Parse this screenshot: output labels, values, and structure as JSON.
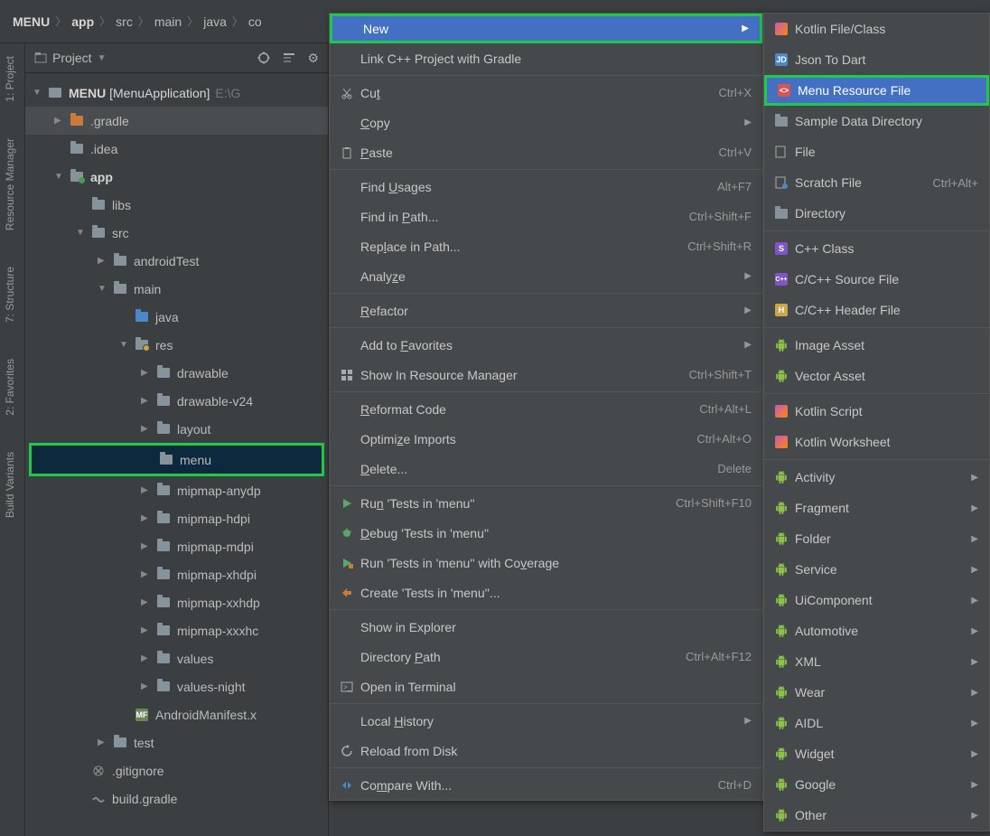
{
  "breadcrumb": [
    "MENU",
    "app",
    "src",
    "main",
    "java",
    "co"
  ],
  "left_rail": [
    {
      "label": "1: Project"
    },
    {
      "label": "Resource Manager"
    },
    {
      "label": "7: Structure"
    },
    {
      "label": "2: Favorites"
    },
    {
      "label": "Build Variants"
    }
  ],
  "project_header": {
    "title": "Project"
  },
  "tree": [
    {
      "indent": 0,
      "arrow": "▼",
      "icon": "module",
      "label": "MENU",
      "bold": true,
      "bracket": "[MenuApplication]",
      "hint": "E:\\G"
    },
    {
      "indent": 1,
      "arrow": "▶",
      "icon": "folder-orange",
      "label": ".gradle",
      "selectedBg": true
    },
    {
      "indent": 1,
      "arrow": "",
      "icon": "folder",
      "label": ".idea"
    },
    {
      "indent": 1,
      "arrow": "▼",
      "icon": "folder-teal",
      "label": "app",
      "bold": true
    },
    {
      "indent": 2,
      "arrow": "",
      "icon": "folder",
      "label": "libs"
    },
    {
      "indent": 2,
      "arrow": "▼",
      "icon": "folder",
      "label": "src"
    },
    {
      "indent": 3,
      "arrow": "▶",
      "icon": "folder",
      "label": "androidTest"
    },
    {
      "indent": 3,
      "arrow": "▼",
      "icon": "folder",
      "label": "main"
    },
    {
      "indent": 4,
      "arrow": "",
      "icon": "folder-blue",
      "label": "java"
    },
    {
      "indent": 4,
      "arrow": "▼",
      "icon": "folder-res",
      "label": "res"
    },
    {
      "indent": 5,
      "arrow": "▶",
      "icon": "folder",
      "label": "drawable"
    },
    {
      "indent": 5,
      "arrow": "▶",
      "icon": "folder",
      "label": "drawable-v24"
    },
    {
      "indent": 5,
      "arrow": "▶",
      "icon": "folder",
      "label": "layout"
    },
    {
      "indent": 5,
      "arrow": "",
      "icon": "folder",
      "label": "menu",
      "selected": true,
      "green": true
    },
    {
      "indent": 5,
      "arrow": "▶",
      "icon": "folder",
      "label": "mipmap-anydp"
    },
    {
      "indent": 5,
      "arrow": "▶",
      "icon": "folder",
      "label": "mipmap-hdpi"
    },
    {
      "indent": 5,
      "arrow": "▶",
      "icon": "folder",
      "label": "mipmap-mdpi"
    },
    {
      "indent": 5,
      "arrow": "▶",
      "icon": "folder",
      "label": "mipmap-xhdpi"
    },
    {
      "indent": 5,
      "arrow": "▶",
      "icon": "folder",
      "label": "mipmap-xxhdp"
    },
    {
      "indent": 5,
      "arrow": "▶",
      "icon": "folder",
      "label": "mipmap-xxxhc"
    },
    {
      "indent": 5,
      "arrow": "▶",
      "icon": "folder",
      "label": "values"
    },
    {
      "indent": 5,
      "arrow": "▶",
      "icon": "folder",
      "label": "values-night"
    },
    {
      "indent": 4,
      "arrow": "",
      "icon": "manifest",
      "label": "AndroidManifest.x"
    },
    {
      "indent": 3,
      "arrow": "▶",
      "icon": "folder",
      "label": "test"
    },
    {
      "indent": 2,
      "arrow": "",
      "icon": "gitignore",
      "label": ".gitignore"
    },
    {
      "indent": 2,
      "arrow": "",
      "icon": "gradle",
      "label": "build.gradle"
    }
  ],
  "context_menu": [
    {
      "type": "item",
      "label": "New",
      "highlighted": true,
      "arrow": true,
      "green": true
    },
    {
      "type": "item",
      "label": "Link C++ Project with Gradle"
    },
    {
      "type": "sep"
    },
    {
      "type": "item",
      "icon": "cut",
      "label": "Cut",
      "u": "t",
      "shortcut": "Ctrl+X"
    },
    {
      "type": "item",
      "label": "Copy",
      "u": "C",
      "arrow": true
    },
    {
      "type": "item",
      "icon": "paste",
      "label": "Paste",
      "u": "P",
      "shortcut": "Ctrl+V"
    },
    {
      "type": "sep"
    },
    {
      "type": "item",
      "label": "Find Usages",
      "u": "U",
      "shortcut": "Alt+F7"
    },
    {
      "type": "item",
      "label": "Find in Path...",
      "u": "P",
      "shortcut": "Ctrl+Shift+F"
    },
    {
      "type": "item",
      "label": "Replace in Path...",
      "u": "l",
      "shortcut": "Ctrl+Shift+R"
    },
    {
      "type": "item",
      "label": "Analyze",
      "u": "z",
      "arrow": true
    },
    {
      "type": "sep"
    },
    {
      "type": "item",
      "label": "Refactor",
      "u": "R",
      "arrow": true
    },
    {
      "type": "sep"
    },
    {
      "type": "item",
      "label": "Add to Favorites",
      "u": "F",
      "arrow": true
    },
    {
      "type": "item",
      "icon": "resmgr",
      "label": "Show In Resource Manager",
      "shortcut": "Ctrl+Shift+T"
    },
    {
      "type": "sep"
    },
    {
      "type": "item",
      "label": "Reformat Code",
      "u": "R",
      "shortcut": "Ctrl+Alt+L"
    },
    {
      "type": "item",
      "label": "Optimize Imports",
      "u": "z",
      "shortcut": "Ctrl+Alt+O"
    },
    {
      "type": "item",
      "label": "Delete...",
      "u": "D",
      "shortcut": "Delete"
    },
    {
      "type": "sep"
    },
    {
      "type": "item",
      "icon": "run",
      "label": "Run 'Tests in 'menu''",
      "u": "n",
      "shortcut": "Ctrl+Shift+F10"
    },
    {
      "type": "item",
      "icon": "debug",
      "label": "Debug 'Tests in 'menu''",
      "u": "D"
    },
    {
      "type": "item",
      "icon": "coverage",
      "label": "Run 'Tests in 'menu'' with Coverage",
      "u": "v"
    },
    {
      "type": "item",
      "icon": "create",
      "label": "Create 'Tests in 'menu''..."
    },
    {
      "type": "sep"
    },
    {
      "type": "item",
      "label": "Show in Explorer"
    },
    {
      "type": "item",
      "label": "Directory Path",
      "u": "P",
      "shortcut": "Ctrl+Alt+F12"
    },
    {
      "type": "item",
      "icon": "terminal",
      "label": "Open in Terminal"
    },
    {
      "type": "sep"
    },
    {
      "type": "item",
      "label": "Local History",
      "u": "H",
      "arrow": true
    },
    {
      "type": "item",
      "icon": "reload",
      "label": "Reload from Disk"
    },
    {
      "type": "sep"
    },
    {
      "type": "item",
      "icon": "compare",
      "label": "Compare With...",
      "u": "m",
      "shortcut": "Ctrl+D"
    }
  ],
  "submenu": [
    {
      "icon": "kotlin",
      "label": "Kotlin File/Class"
    },
    {
      "icon": "jd",
      "label": "Json To Dart"
    },
    {
      "icon": "menu-res",
      "label": "Menu Resource File",
      "highlighted": true
    },
    {
      "icon": "folder",
      "label": "Sample Data Directory"
    },
    {
      "icon": "file",
      "label": "File"
    },
    {
      "icon": "scratch",
      "label": "Scratch File",
      "shortcut": "Ctrl+Alt+"
    },
    {
      "icon": "folder",
      "label": "Directory"
    },
    {
      "sep": true
    },
    {
      "icon": "cpp-s",
      "label": "C++ Class"
    },
    {
      "icon": "cpp-src",
      "label": "C/C++ Source File"
    },
    {
      "icon": "cpp-h",
      "label": "C/C++ Header File"
    },
    {
      "sep": true
    },
    {
      "icon": "android",
      "label": "Image Asset"
    },
    {
      "icon": "android",
      "label": "Vector Asset"
    },
    {
      "sep": true
    },
    {
      "icon": "kotlin",
      "label": "Kotlin Script"
    },
    {
      "icon": "kotlin",
      "label": "Kotlin Worksheet"
    },
    {
      "sep": true
    },
    {
      "icon": "android",
      "label": "Activity",
      "arrow": true
    },
    {
      "icon": "android",
      "label": "Fragment",
      "arrow": true
    },
    {
      "icon": "android",
      "label": "Folder",
      "arrow": true
    },
    {
      "icon": "android",
      "label": "Service",
      "arrow": true
    },
    {
      "icon": "android",
      "label": "UiComponent",
      "arrow": true
    },
    {
      "icon": "android",
      "label": "Automotive",
      "arrow": true
    },
    {
      "icon": "android",
      "label": "XML",
      "arrow": true
    },
    {
      "icon": "android",
      "label": "Wear",
      "arrow": true
    },
    {
      "icon": "android",
      "label": "AIDL",
      "arrow": true
    },
    {
      "icon": "android",
      "label": "Widget",
      "arrow": true
    },
    {
      "icon": "android",
      "label": "Google",
      "arrow": true
    },
    {
      "icon": "android",
      "label": "Other",
      "arrow": true
    }
  ]
}
